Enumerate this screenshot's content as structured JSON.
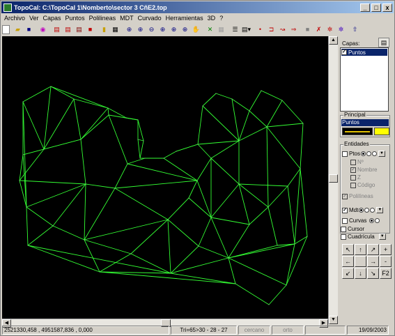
{
  "window": {
    "title": "TopoCal: C:\\TopoCal 1\\Nomberto\\sector 3 CñE2.top",
    "min": "_",
    "max": "□",
    "close": "x"
  },
  "menu": [
    "Archivo",
    "Ver",
    "Capas",
    "Puntos",
    "Polilineas",
    "MDT",
    "Curvado",
    "Herramientas",
    "3D",
    "?"
  ],
  "colors": {
    "accent": "#0a246a",
    "mesh": "#33ff33",
    "canvas": "#000000",
    "yellow": "#ffff00"
  },
  "panel": {
    "capas": {
      "title": "Capas:",
      "layer": "Puntos"
    },
    "principal": {
      "title": "Principal",
      "layer": "Puntos"
    },
    "entidades": {
      "title": "Entidades",
      "ptos": "Ptos",
      "n": "Nº",
      "nombre": "Nombre",
      "z": "Z",
      "codigo": "Código",
      "polilineas": "Polilíneas",
      "mdt": "Mdt",
      "curvas": "Curvas",
      "cursor": "Cursor",
      "cuadricula": "Cuadrícula"
    },
    "nav": [
      "↖",
      "↑",
      "↗",
      "+",
      "←",
      "",
      "→",
      "-",
      "↙",
      "↓",
      "↘",
      "F2"
    ]
  },
  "status": {
    "coords": "2521330,458 , 4951587,836 , 0,000",
    "tri": "Tri=65>30 - 28 - 27",
    "cercano": "cercano",
    "orto": "orto",
    "date": "19/09/2003"
  }
}
